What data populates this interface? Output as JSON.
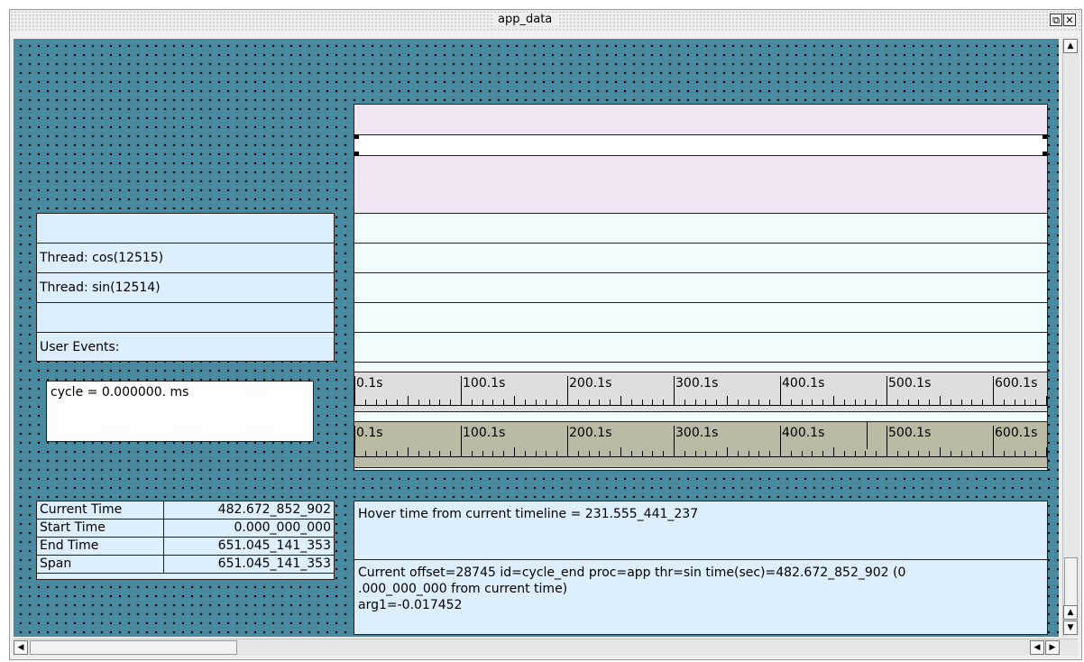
{
  "window": {
    "title": "app_data",
    "restore_icon": "restore-icon",
    "close_icon": "close-icon"
  },
  "threads": {
    "rows": [
      "",
      "Thread: cos(12515)",
      "Thread: sin(12514)",
      "",
      "User Events:"
    ]
  },
  "cycle": {
    "text": "cycle = 0.000000. ms"
  },
  "ruler": {
    "labels": [
      "0.1s",
      "100.1s",
      "200.1s",
      "300.1s",
      "400.1s",
      "500.1s",
      "600.1s"
    ]
  },
  "times": {
    "rows": [
      {
        "label": "Current Time",
        "value": "482.672_852_902"
      },
      {
        "label": "Start Time",
        "value": "0.000_000_000"
      },
      {
        "label": "End Time",
        "value": "651.045_141_353"
      },
      {
        "label": "Span",
        "value": "651.045_141_353"
      }
    ]
  },
  "info": {
    "hover": "Hover time from current timeline = 231.555_441_237",
    "detail_line1": "Current offset=28745  id=cycle_end  proc=app  thr=sin  time(sec)=482.672_852_902   (0",
    "detail_line2": ".000_000_000 from current time)",
    "detail_line3": "arg1=-0.017452"
  },
  "colors": {
    "canvas": "#4a8aa0",
    "panel": "#ddeefc",
    "timeline_top": "#f0e6f4",
    "timeline_rows": "#effdff",
    "ruler1": "#dedede",
    "ruler2": "#babaa5"
  }
}
